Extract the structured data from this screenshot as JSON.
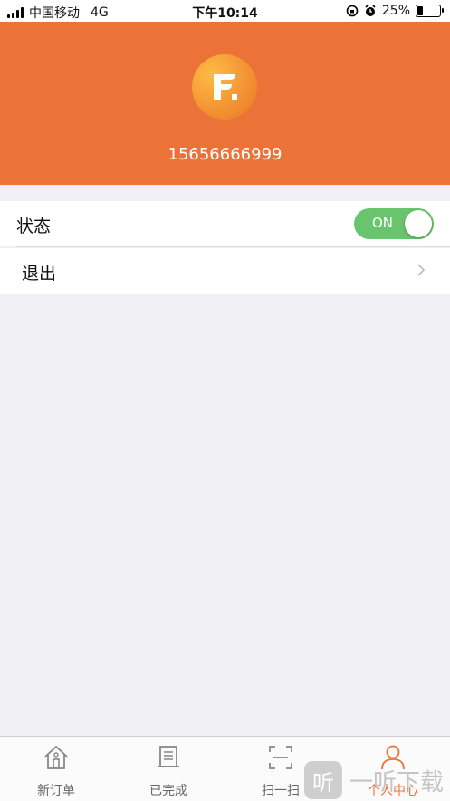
{
  "status_bar": {
    "carrier": "中国移动",
    "network": "4G",
    "time": "下午10:14",
    "battery": "25%"
  },
  "profile": {
    "logo_letter": "F.",
    "phone": "15656666999",
    "accent_color": "#ec7338"
  },
  "settings": {
    "status_label": "状态",
    "status_toggle_label": "ON",
    "status_on": true,
    "logout_label": "退出"
  },
  "tabbar": {
    "tabs": [
      {
        "label": "新订单",
        "icon": "home-icon",
        "active": false
      },
      {
        "label": "已完成",
        "icon": "document-icon",
        "active": false
      },
      {
        "label": "扫一扫",
        "icon": "scan-icon",
        "active": false
      },
      {
        "label": "个人中心",
        "icon": "person-icon",
        "active": true
      }
    ]
  },
  "watermark": {
    "glyph": "听",
    "text": "一听下载"
  }
}
